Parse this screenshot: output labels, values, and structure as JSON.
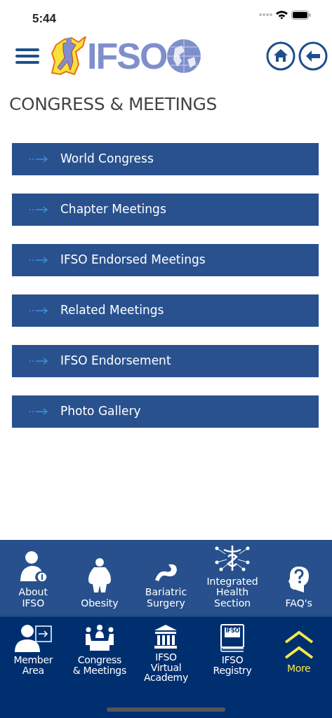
{
  "status_bar": {
    "time": "5:44"
  },
  "header": {
    "logo_text": "IFSO"
  },
  "title": "CONGRESS & MEETINGS",
  "menu": [
    {
      "label": "World Congress"
    },
    {
      "label": "Chapter Meetings"
    },
    {
      "label": "IFSO Endorsed Meetings"
    },
    {
      "label": "Related Meetings"
    },
    {
      "label": "IFSO Endorsement"
    },
    {
      "label": "Photo Gallery"
    }
  ],
  "more_panel": [
    {
      "label": "About\nIFSO"
    },
    {
      "label": "Obesity"
    },
    {
      "label": "Bariatric\nSurgery"
    },
    {
      "label": "Integrated\nHealth\nSection"
    },
    {
      "label": "FAQ's"
    }
  ],
  "tab_bar": [
    {
      "kind": "nav",
      "label": "Member\nArea"
    },
    {
      "kind": "nav",
      "label": "Congress\n& Meetings"
    },
    {
      "kind": "nav",
      "label": "IFSO\nVirtual\nAcademy"
    },
    {
      "kind": "nav",
      "label": "IFSO\nRegistry",
      "icon_text": "IFSO"
    },
    {
      "kind": "more",
      "label": "More",
      "selected": true
    }
  ]
}
